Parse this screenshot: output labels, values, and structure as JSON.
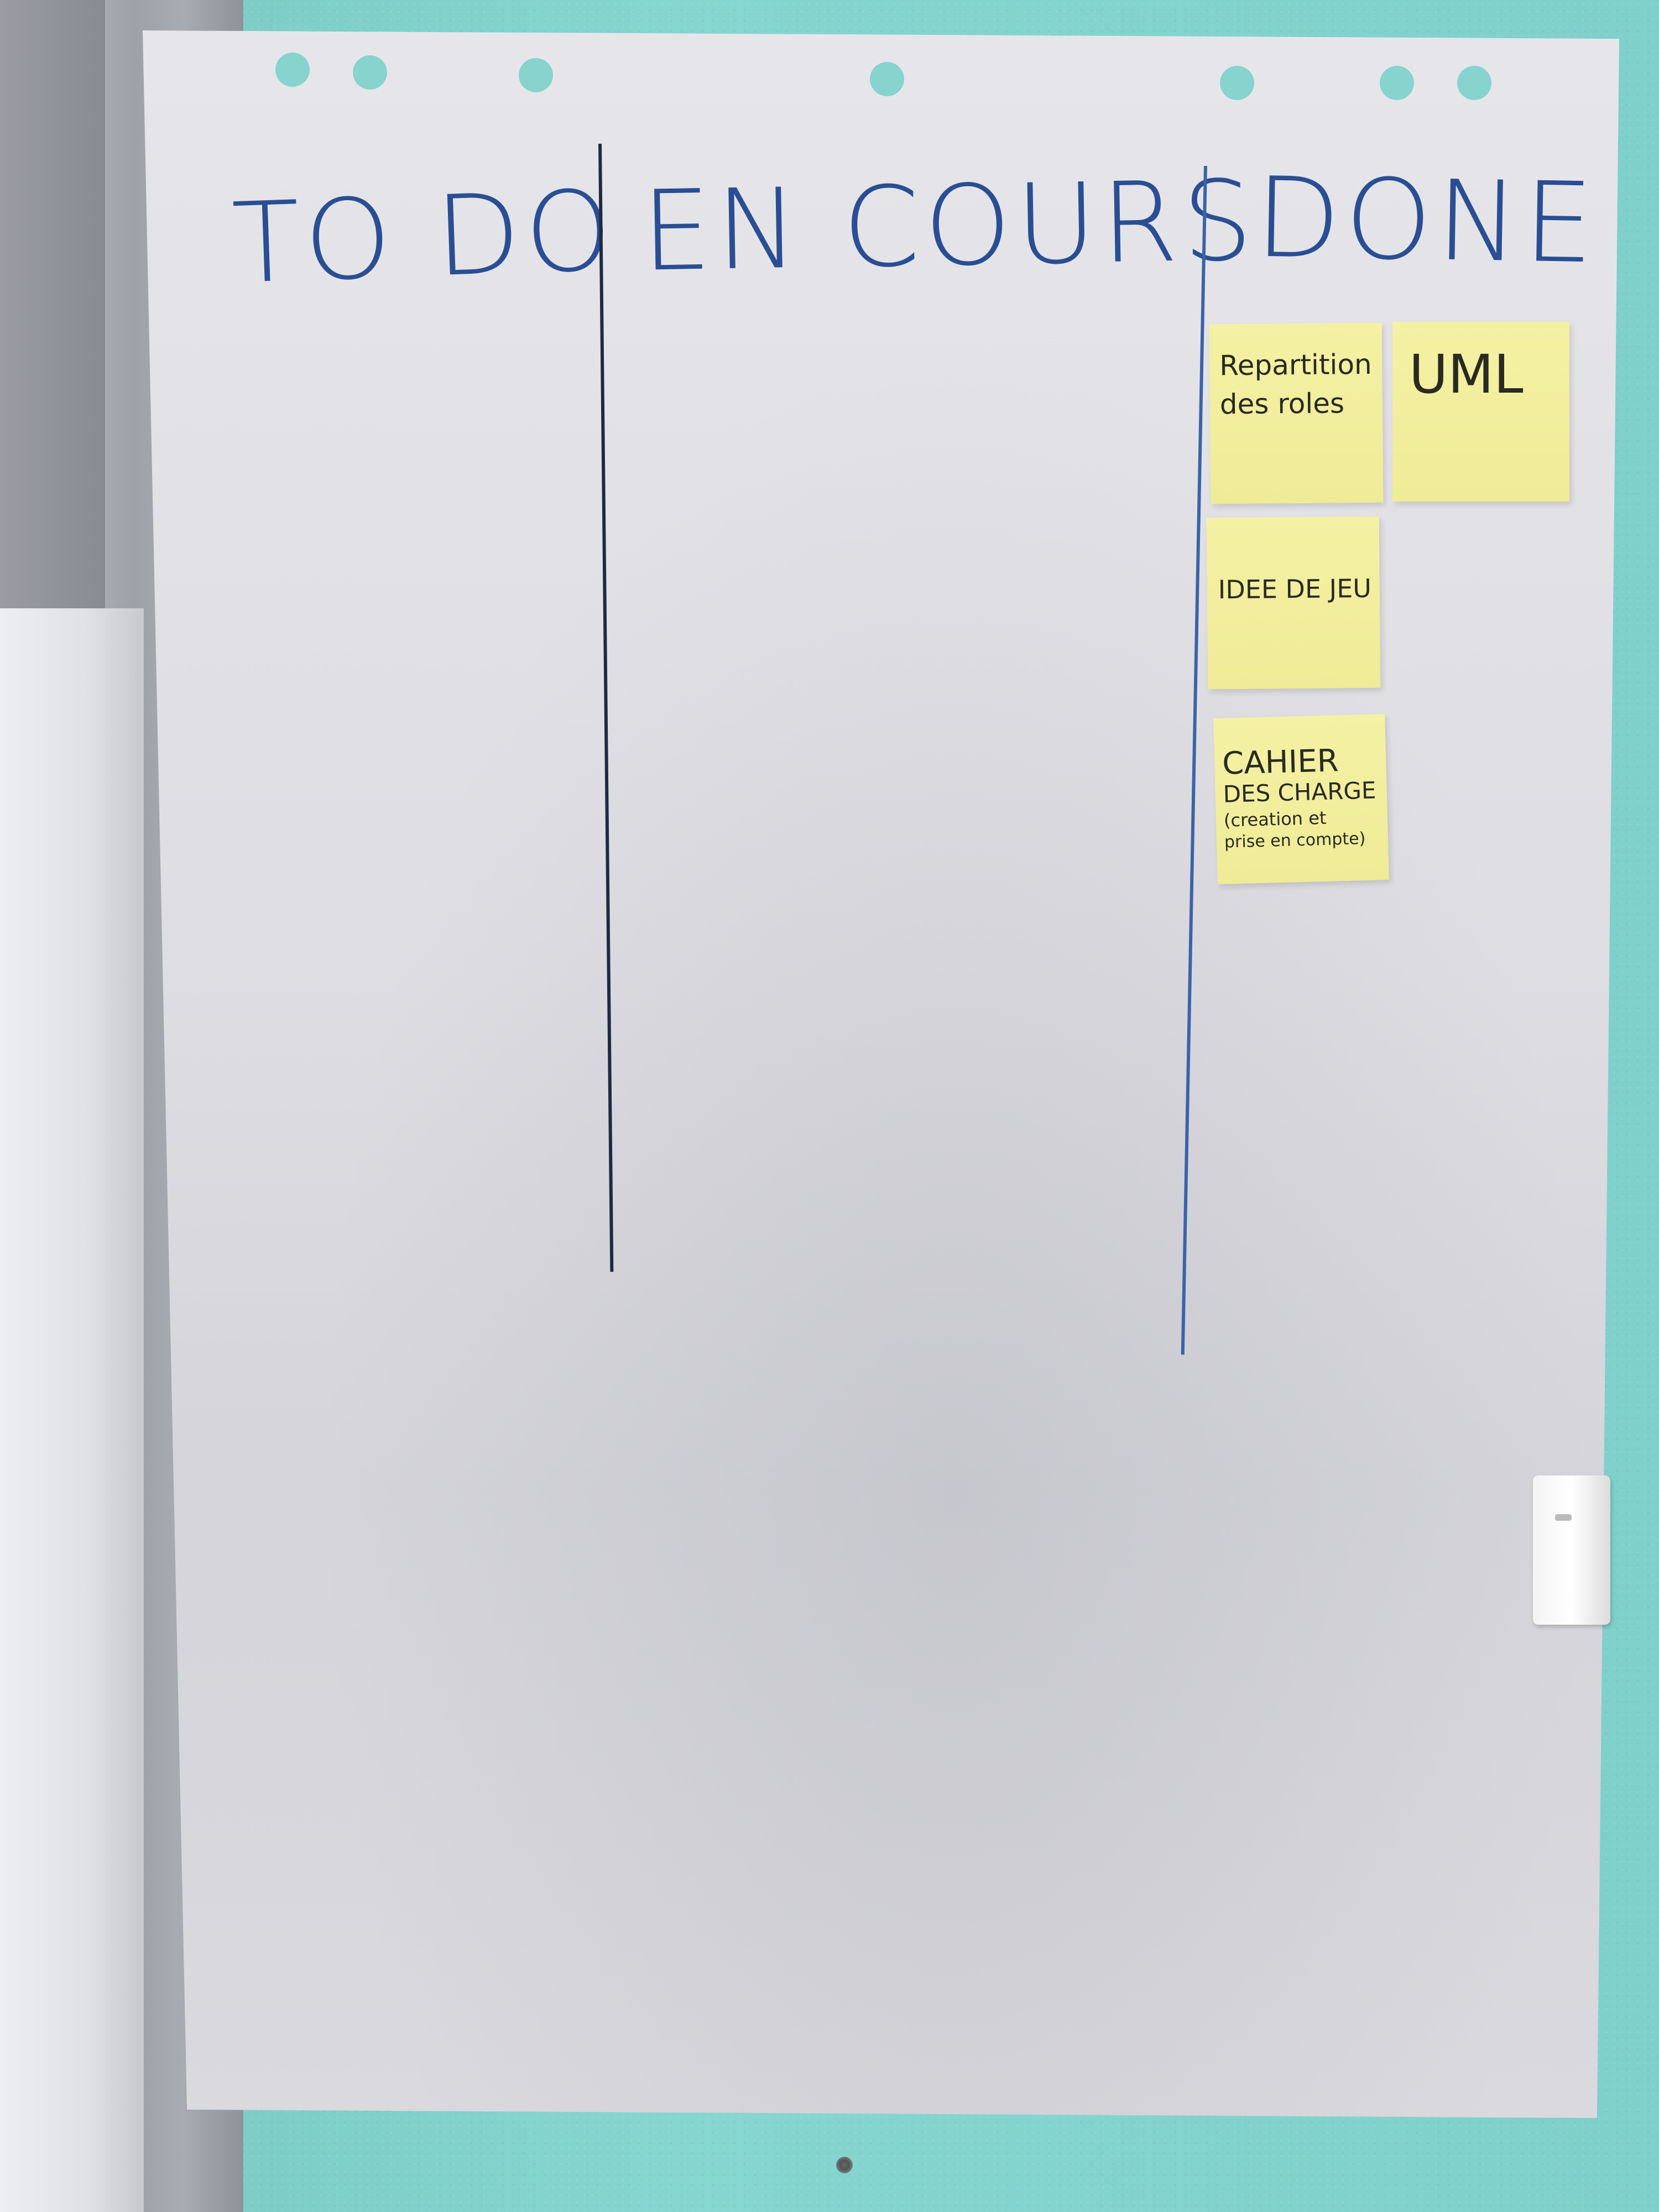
{
  "board": {
    "columns": [
      {
        "header": "TO DO",
        "notes": []
      },
      {
        "header": "EN COURS",
        "notes": []
      },
      {
        "header": "DONE",
        "notes": [
          {
            "lines": [
              "Repartition",
              "des roles"
            ]
          },
          {
            "lines": [
              "UML"
            ]
          },
          {
            "lines": [
              "IDEE DE JEU"
            ]
          },
          {
            "lines": [
              "CAHIER",
              "DES CHARGE",
              "(creation et",
              "prise en compte)"
            ]
          }
        ]
      }
    ]
  },
  "colors": {
    "wall": "#7fcfc9",
    "paper": "#dddde2",
    "marker_ink": "#2a4e93",
    "sticky_note": "#f2ef9e",
    "note_ink": "#2a2a22"
  }
}
